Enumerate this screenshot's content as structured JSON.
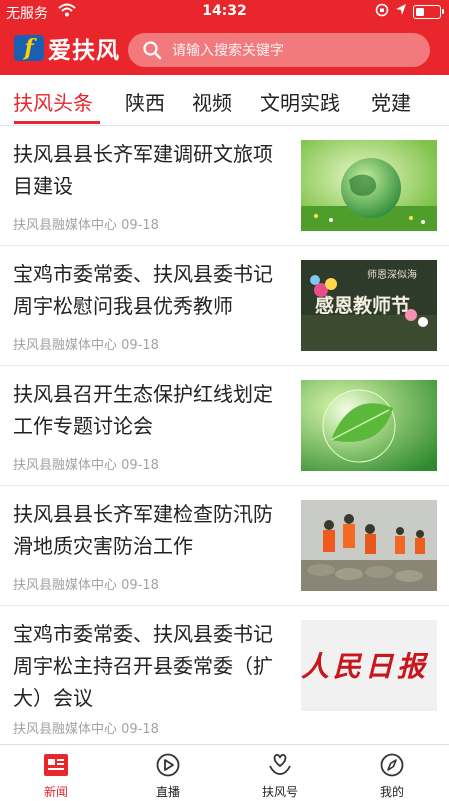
{
  "status_bar": {
    "carrier": "无服务",
    "time": "14:32"
  },
  "header": {
    "logo_text": "爱扶风",
    "logo_mark": "f",
    "search_placeholder": "请输入搜索关键字"
  },
  "tabs": [
    {
      "label": "扶风头条",
      "active": true
    },
    {
      "label": "陕西"
    },
    {
      "label": "视频"
    },
    {
      "label": "文明实践"
    },
    {
      "label": "党建"
    }
  ],
  "news": [
    {
      "title": "扶风县县长齐军建调研文旅项目建设",
      "source": "扶风县融媒体中心",
      "date": "09-18",
      "thumb": "globe-grass-image"
    },
    {
      "title": "宝鸡市委常委、扶风县委书记周宇松慰问我县优秀教师",
      "source": "扶风县融媒体中心",
      "date": "09-18",
      "thumb": "teachers-day-card-image",
      "thumb_text_top": "师恩深似海",
      "thumb_text_main": "感恩教师节"
    },
    {
      "title": "扶风县召开生态保护红线划定工作专题讨论会",
      "source": "扶风县融媒体中心",
      "date": "09-18",
      "thumb": "leaf-bubble-image"
    },
    {
      "title": "扶风县县长齐军建检查防汛防滑地质灾害防治工作",
      "source": "扶风县融媒体中心",
      "date": "09-18",
      "thumb": "flood-rescue-image"
    },
    {
      "title": "宝鸡市委常委、扶风县委书记周宇松主持召开县委常委（扩大）会议",
      "source": "扶风县融媒体中心",
      "date": "09-18",
      "thumb": "peoples-daily-logo-image",
      "thumb_text": "人民日报"
    }
  ],
  "tabbar": [
    {
      "label": "新闻",
      "icon": "news-icon",
      "active": true
    },
    {
      "label": "直播",
      "icon": "play-icon"
    },
    {
      "label": "扶风号",
      "icon": "heart-hand-icon"
    },
    {
      "label": "我的",
      "icon": "compass-icon"
    }
  ],
  "colors": {
    "brand_red": "#e8262c",
    "search_bg": "#f37a7c",
    "meta_gray": "#a3a3a3"
  }
}
